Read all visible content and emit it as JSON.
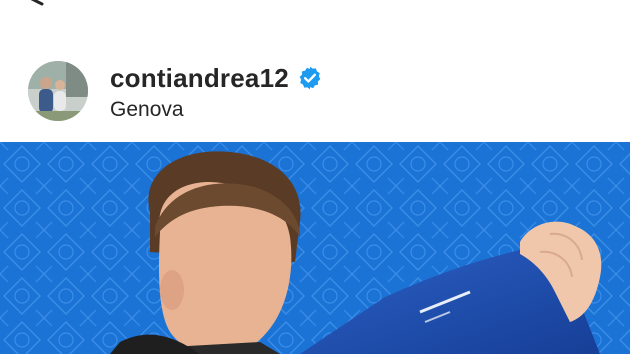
{
  "post": {
    "username": "contiandrea12",
    "location": "Genova"
  },
  "icons": {
    "back": "back-arrow-icon",
    "verified": "verified-badge-icon"
  },
  "colors": {
    "text": "#262626",
    "verified": "#1d9bf0",
    "image_background": "#1a6fd0"
  }
}
